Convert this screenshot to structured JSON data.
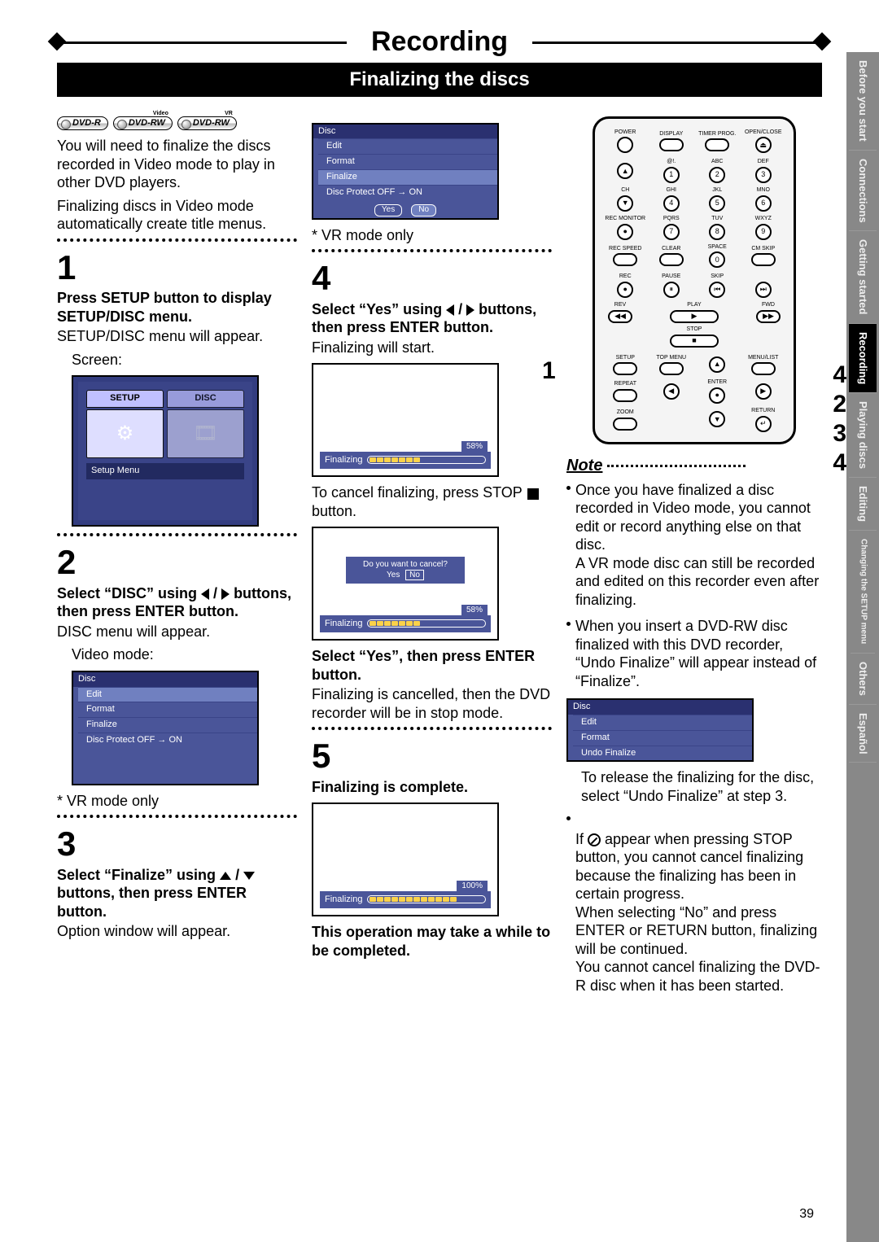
{
  "header": {
    "title": "Recording",
    "subtitle": "Finalizing the discs"
  },
  "sidenav": {
    "items": [
      {
        "label": "Before you start",
        "active": false
      },
      {
        "label": "Connections",
        "active": false
      },
      {
        "label": "Getting started",
        "active": false
      },
      {
        "label": "Recording",
        "active": true
      },
      {
        "label": "Playing discs",
        "active": false
      },
      {
        "label": "Editing",
        "active": false
      },
      {
        "label": "Changing the SETUP menu",
        "active": false
      },
      {
        "label": "Others",
        "active": false
      },
      {
        "label": "Español",
        "active": false
      }
    ]
  },
  "badges": [
    "DVD-R",
    "DVD-RW",
    "DVD-RW"
  ],
  "badge_tags": [
    "",
    "Video",
    "VR"
  ],
  "col1": {
    "intro": "You will need to finalize the discs recorded in Video mode to play in other DVD players.",
    "intro2": "Finalizing discs in Video mode automatically create title menus.",
    "step1": {
      "num": "1",
      "bold": "Press SETUP button to display SETUP/DISC menu.",
      "body": "SETUP/DISC menu will appear.",
      "screen_label": "Screen:",
      "setup_tabs": [
        "SETUP",
        "DISC"
      ],
      "setup_foot": "Setup Menu"
    },
    "step2": {
      "num": "2",
      "bold_pre": "Select “DISC” using ",
      "bold_post": " buttons, then press ENTER button.",
      "body": "DISC menu will appear.",
      "screen_label": "Video mode:",
      "menu_hdr": "Disc",
      "menu_items": [
        "Edit",
        "Format",
        "Finalize",
        "Disc Protect OFF → ON"
      ],
      "vr_note": "* VR mode only"
    },
    "step3": {
      "num": "3",
      "bold_pre": "Select “Finalize” using ",
      "bold_post": " buttons, then press ENTER button.",
      "body": "Option window will appear."
    }
  },
  "col2": {
    "top_menu": {
      "hdr": "Disc",
      "items": [
        "Edit",
        "Format",
        "Finalize",
        "Disc Protect OFF → ON"
      ],
      "yes": "Yes",
      "no": "No"
    },
    "vr_note": "* VR mode only",
    "step4": {
      "num": "4",
      "bold_pre": "Select “Yes” using ",
      "bold_post": " buttons, then press ENTER button.",
      "body": "Finalizing will start.",
      "pct1": "58%",
      "fin_label": "Finalizing",
      "cancel_text": "To cancel finalizing, press STOP ",
      "cancel_text2": " button.",
      "cancel_prompt": "Do you want to cancel?",
      "cancel_yes": "Yes",
      "cancel_no": "No",
      "pct2": "58%",
      "sel_yes_bold": "Select “Yes”, then press ENTER button.",
      "sel_yes_body": "Finalizing is cancelled, then the DVD recorder will be in stop mode."
    },
    "step5": {
      "num": "5",
      "bold": "Finalizing is complete.",
      "pct": "100%",
      "fin_label": "Finalizing",
      "warn": "This operation may take a while to be completed."
    }
  },
  "col3": {
    "note_hdr": "Note",
    "note1": "Once you have finalized a disc recorded in Video mode, you cannot edit or record anything else on that disc.\nA VR mode disc can still be recorded and edited on this recorder even after finalizing.",
    "note2": "When you insert a DVD-RW disc finalized with this DVD recorder, “Undo Finalize” will appear instead of  “Finalize”.",
    "undo_menu": {
      "hdr": "Disc",
      "items": [
        "Edit",
        "Format",
        "Undo Finalize"
      ]
    },
    "note2b": "To release the finalizing for the disc, select “Undo Finalize” at step 3.",
    "note3_pre": "If ",
    "note3_post": " appear when pressing STOP button, you cannot cancel finalizing because the finalizing has been in certain progress.\nWhen selecting “No” and press ENTER or RETURN button, finalizing will be continued.\nYou cannot cancel finalizing the DVD-R disc when it has been started."
  },
  "remote": {
    "labels_row1": [
      "POWER",
      "",
      "",
      "OPEN/CLOSE"
    ],
    "labels_row1b": [
      "",
      "DISPLAY",
      "TIMER PROG.",
      ""
    ],
    "labels_set": [
      "",
      "@!.",
      "ABC",
      "DEF",
      "CH",
      "GHI",
      "JKL",
      "MNO",
      "",
      "PQRS",
      "TUV",
      "WXYZ"
    ],
    "nums": [
      "1",
      "2",
      "3",
      "4",
      "5",
      "6",
      "7",
      "8",
      "9"
    ],
    "labels_row_bottom": [
      "REC SPEED",
      "CLEAR",
      "SPACE",
      "CM SKIP"
    ],
    "zero": "0",
    "labels_row_rec": [
      "REC",
      "PAUSE",
      "",
      "SKIP"
    ],
    "play": "PLAY",
    "rev": "REV",
    "fwd": "FWD",
    "stop": "STOP",
    "nav_row": [
      "SETUP",
      "TOP MENU",
      "",
      "MENU/LIST"
    ],
    "nav_row2": [
      "REPEAT",
      "",
      "ENTER",
      ""
    ],
    "nav_row3": [
      "ZOOM",
      "",
      "",
      "RETURN"
    ],
    "callouts_left": [
      "1"
    ],
    "callouts_right": [
      "4",
      "2",
      "3",
      "4"
    ]
  },
  "page_number": "39"
}
